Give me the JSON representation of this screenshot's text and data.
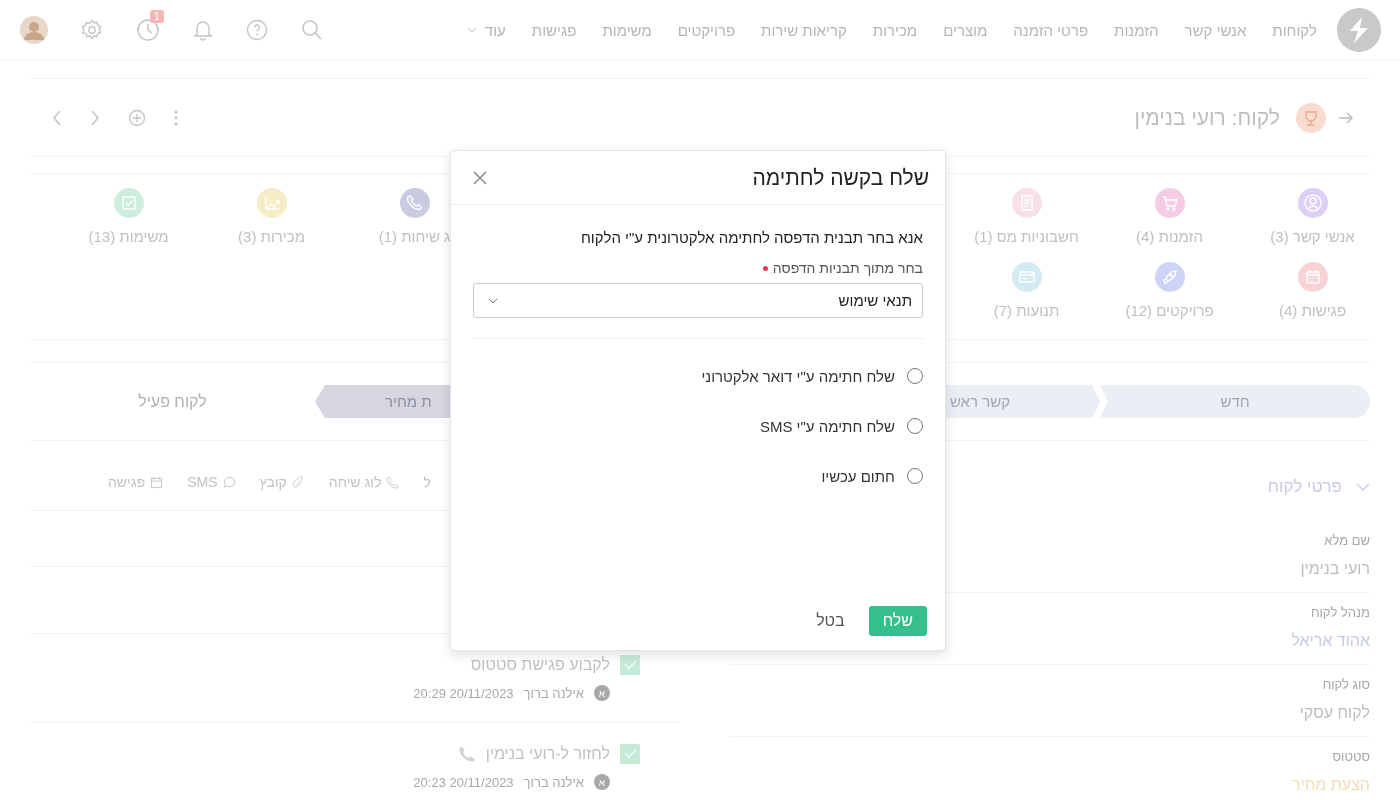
{
  "nav": {
    "items": [
      "לקוחות",
      "אנשי קשר",
      "הזמנות",
      "פרטי הזמנה",
      "מוצרים",
      "מכירות",
      "קריאות שירות",
      "פרויקטים",
      "משימות",
      "פגישות"
    ],
    "more": "עוד",
    "notification_count": "1"
  },
  "record": {
    "title": "לקוח: רועי בנימין"
  },
  "modules": {
    "right": [
      {
        "label": "אנשי קשר (3)",
        "kind": "person",
        "color": "#dcd0f6"
      },
      {
        "label": "הזמנות (4)",
        "kind": "cart",
        "color": "#f5cce6"
      },
      {
        "label": "חשבוניות מס (1)",
        "kind": "invoice",
        "color": "#f7e0ea"
      }
    ],
    "left": [
      {
        "label": "ג שיחות (1)",
        "kind": "phone",
        "color": "#c9cce0"
      },
      {
        "label": "מכירות (3)",
        "kind": "chart",
        "color": "#f6ecc6"
      },
      {
        "label": "משימות (13)",
        "kind": "check",
        "color": "#cdeedd"
      }
    ],
    "second_row": [
      {
        "label": "פגישות (4)",
        "kind": "calendar",
        "color": "#f8d3d6"
      },
      {
        "label": "פרויקטים (12)",
        "kind": "rocket",
        "color": "#cdd4f6"
      },
      {
        "label": "תנועות (7)",
        "kind": "card",
        "color": "#d2ebf3"
      }
    ]
  },
  "stages": [
    {
      "label": "חדש",
      "selected": false,
      "done": true
    },
    {
      "label": "קשר ראש",
      "selected": false,
      "done": true
    },
    {
      "label": "ת מחיר",
      "selected": true,
      "done": true
    },
    {
      "label": "לקוח פעיל",
      "selected": false,
      "done": false
    }
  ],
  "actions": [
    {
      "label": "ל",
      "kind": "none"
    },
    {
      "label": "לוג שיחה",
      "kind": "phone"
    },
    {
      "label": "קובץ",
      "kind": "clip"
    },
    {
      "label": "SMS",
      "kind": "chat"
    },
    {
      "label": "פגישה",
      "kind": "calendar"
    }
  ],
  "tasks": [
    {
      "title": "לקבוע פגישת סטטוס",
      "checked": true,
      "phone": false,
      "initial": "א",
      "user": "אילנה ברוך",
      "time": "20/11/2023 20:29"
    },
    {
      "title": "לחזור ל-רועי בנימין",
      "checked": true,
      "phone": true,
      "initial": "א",
      "user": "אילנה ברוך",
      "time": "20/11/2023 20:23"
    }
  ],
  "details": {
    "title": "פרטי לקוח",
    "expanded": true,
    "fields": [
      {
        "label": "שם מלא",
        "value": "רועי בנימין",
        "kind": "text"
      },
      {
        "label": "מנהל לקוח",
        "value": "אהוד אריאל",
        "kind": "link"
      },
      {
        "label": "סוג לקוח",
        "value": "לקוח עסקי",
        "kind": "text"
      },
      {
        "label": "סטטוס",
        "value": "הצעת מחיר",
        "kind": "status"
      }
    ]
  },
  "modal": {
    "title": "שלח בקשה לחתימה",
    "prompt": "אנא בחר תבנית הדפסה לחתימה אלקטרונית ע\"י הלקוח",
    "select_label": "בחר מתוך תבניות הדפסה",
    "required": true,
    "select_value": "תנאי שימוש",
    "options": [
      {
        "label": "שלח חתימה ע\"י דואר אלקטרוני",
        "selected": false
      },
      {
        "label": "שלח חתימה ע\"י SMS",
        "selected": false
      },
      {
        "label": "חתום עכשיו",
        "selected": false
      }
    ],
    "submit": "שלח",
    "cancel": "בטל"
  }
}
